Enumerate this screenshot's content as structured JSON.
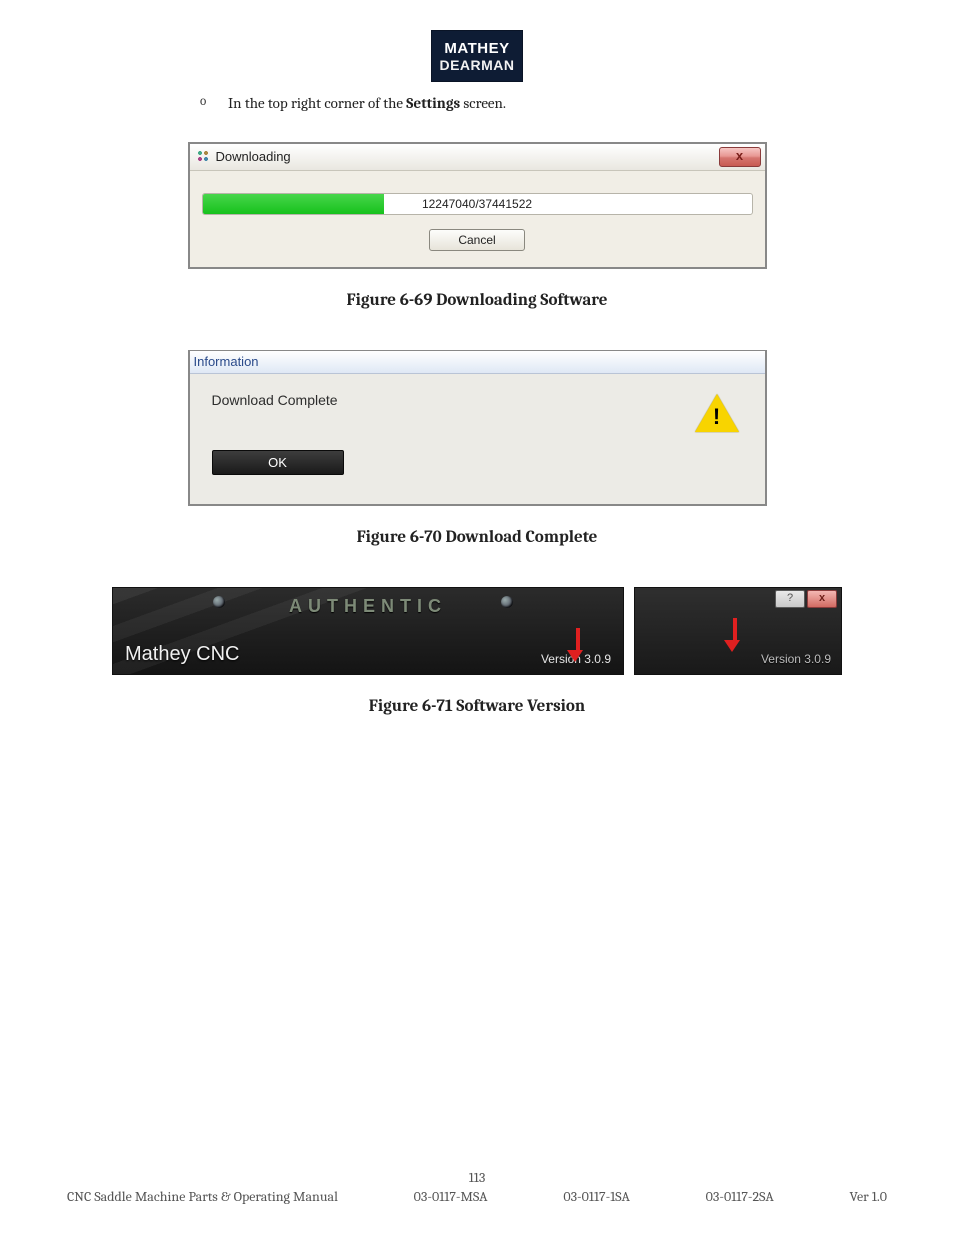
{
  "logo": {
    "line1": "MATHEY",
    "line2": "DEARMAN"
  },
  "bullet": {
    "marker": "o",
    "pre": "In the top right corner of the ",
    "bold": "Settings",
    "post": " screen."
  },
  "dialog1": {
    "title": "Downloading",
    "close_glyph": "x",
    "progress_label": "12247040/37441522",
    "progress_percent": 33,
    "cancel_label": "Cancel"
  },
  "caption1": "Figure 6-69 Downloading Software",
  "dialog2": {
    "title": "Information",
    "message": "Download Complete",
    "ok_label": "OK",
    "warn_glyph": "!"
  },
  "caption2": "Figure 6-70 Download Complete",
  "fig3": {
    "authentic": "AUTHENTIC",
    "product": "Mathey CNC",
    "versionA": "Version 3.0.9",
    "versionB": "Version 3.0.9",
    "help_glyph": "?",
    "close_glyph": "x"
  },
  "caption3": "Figure 6-71 Software Version",
  "footer": {
    "page_number": "113",
    "manual_title": "CNC Saddle Machine Parts & Operating Manual",
    "code1": "03-0117-MSA",
    "code2": "03-0117-1SA",
    "code3": "03-0117-2SA",
    "version": "Ver 1.0"
  }
}
